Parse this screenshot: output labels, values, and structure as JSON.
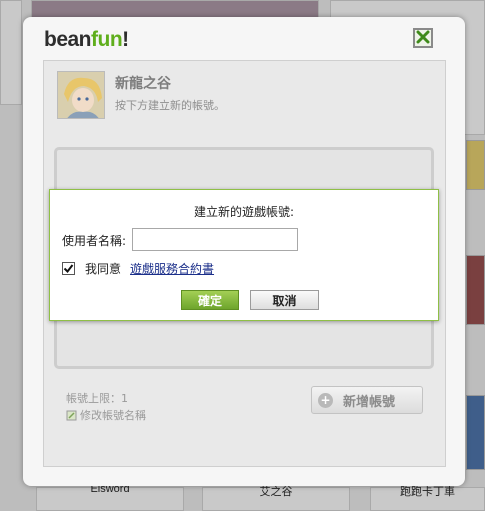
{
  "background": {
    "labels": [
      "Elsword",
      "艾之谷",
      "跑跑卡丁車"
    ]
  },
  "dialog": {
    "logo": {
      "part1": "bean",
      "part2": "fun",
      "part3": "!"
    },
    "game": {
      "title": "新龍之谷",
      "subtitle": "按下方建立新的帳號。"
    },
    "account_limit": "帳號上限：1",
    "rename_link": "修改帳號名稱",
    "add_account_button": "新增帳號"
  },
  "create_popup": {
    "title": "建立新的遊戲帳號:",
    "username_label": "使用者名稱:",
    "username_value": "",
    "agree_label": "我同意",
    "agree_checked": true,
    "terms_link": "遊戲服務合約書",
    "confirm_button": "確定",
    "cancel_button": "取消"
  },
  "colors": {
    "brand_green": "#5fae1c",
    "confirm_green": "#6ea52c",
    "popup_border": "#8fbf46",
    "link_blue": "#1b2f8a"
  },
  "icons": [
    "close-icon",
    "pencil-icon",
    "plus-icon",
    "checkmark-icon"
  ]
}
